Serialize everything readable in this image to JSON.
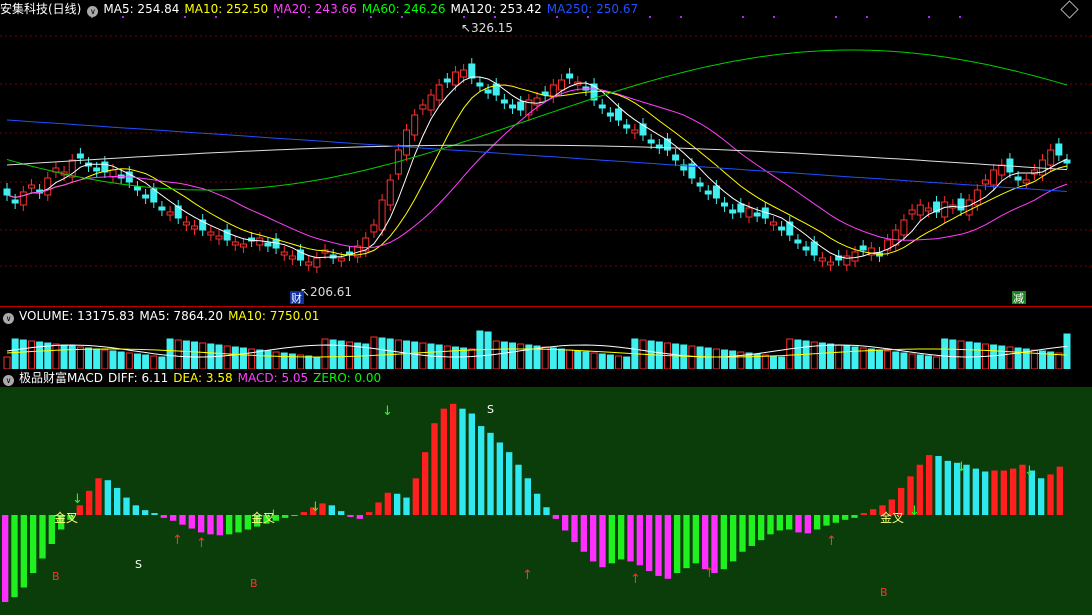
{
  "price": {
    "title": "安集科技(日线)",
    "ma": [
      {
        "label": "MA5: 254.84",
        "color": "#ffffff"
      },
      {
        "label": "MA10: 252.50",
        "color": "#ffff00"
      },
      {
        "label": "MA20: 243.66",
        "color": "#ff40ff"
      },
      {
        "label": "MA60: 246.26",
        "color": "#00ff00"
      },
      {
        "label": "MA120: 253.42",
        "color": "#ffffff"
      },
      {
        "label": "MA250: 250.67",
        "color": "#2050ff"
      }
    ],
    "high_label": "326.15",
    "low_label": "206.61",
    "marker_cai": "财",
    "marker_jian": "减"
  },
  "volume": {
    "labels": [
      {
        "label": "VOLUME: 13175.83",
        "color": "#ffffff"
      },
      {
        "label": "MA5: 7864.20",
        "color": "#ffffff"
      },
      {
        "label": "MA10: 7750.01",
        "color": "#ffff00"
      }
    ]
  },
  "macd": {
    "labels": [
      {
        "label": "极品财富MACD",
        "color": "#ffffff"
      },
      {
        "label": "DIFF: 6.11",
        "color": "#ffffff"
      },
      {
        "label": "DEA: 3.58",
        "color": "#ffff00"
      },
      {
        "label": "MACD: 5.05",
        "color": "#ff40ff"
      },
      {
        "label": "ZERO: 0.00",
        "color": "#00ff00"
      }
    ],
    "gold_cross": "金叉",
    "signal_s": "S",
    "signal_b": "B"
  },
  "chart_data": {
    "type": "bar",
    "description_series": "MACD histogram per bar (approximate)",
    "macd_hist": [
      -9.0,
      -8.5,
      -7.5,
      -6.0,
      -4.5,
      -3.0,
      -1.5,
      -0.5,
      1.0,
      2.5,
      3.8,
      3.6,
      2.8,
      1.8,
      1.0,
      0.5,
      0.2,
      -0.3,
      -0.6,
      -1.0,
      -1.4,
      -1.8,
      -2.0,
      -2.1,
      -2.0,
      -1.8,
      -1.5,
      -1.2,
      -0.9,
      -0.6,
      -0.3,
      -0.1,
      0.3,
      0.8,
      1.2,
      1.0,
      0.4,
      -0.2,
      -0.4,
      0.3,
      1.3,
      2.3,
      2.2,
      1.8,
      3.8,
      6.5,
      9.5,
      11.0,
      11.5,
      11.0,
      10.5,
      9.2,
      8.5,
      7.5,
      6.5,
      5.2,
      3.8,
      2.2,
      0.8,
      -0.4,
      -1.6,
      -2.8,
      -3.8,
      -4.8,
      -5.4,
      -5.0,
      -4.6,
      -4.8,
      -5.2,
      -5.8,
      -6.3,
      -6.6,
      -6.0,
      -5.5,
      -5.0,
      -5.6,
      -6.0,
      -5.6,
      -4.8,
      -3.8,
      -3.2,
      -2.6,
      -2.0,
      -1.6,
      -1.5,
      -1.8,
      -1.9,
      -1.5,
      -1.1,
      -0.8,
      -0.5,
      -0.3,
      0.2,
      0.6,
      1.0,
      1.6,
      2.8,
      4.0,
      5.2,
      6.2,
      6.1,
      5.6,
      5.4,
      5.2,
      4.8,
      4.5,
      4.6,
      4.6,
      4.8,
      5.2,
      4.6,
      3.8,
      4.2,
      5.0
    ],
    "ylim": [
      -10,
      12
    ]
  }
}
